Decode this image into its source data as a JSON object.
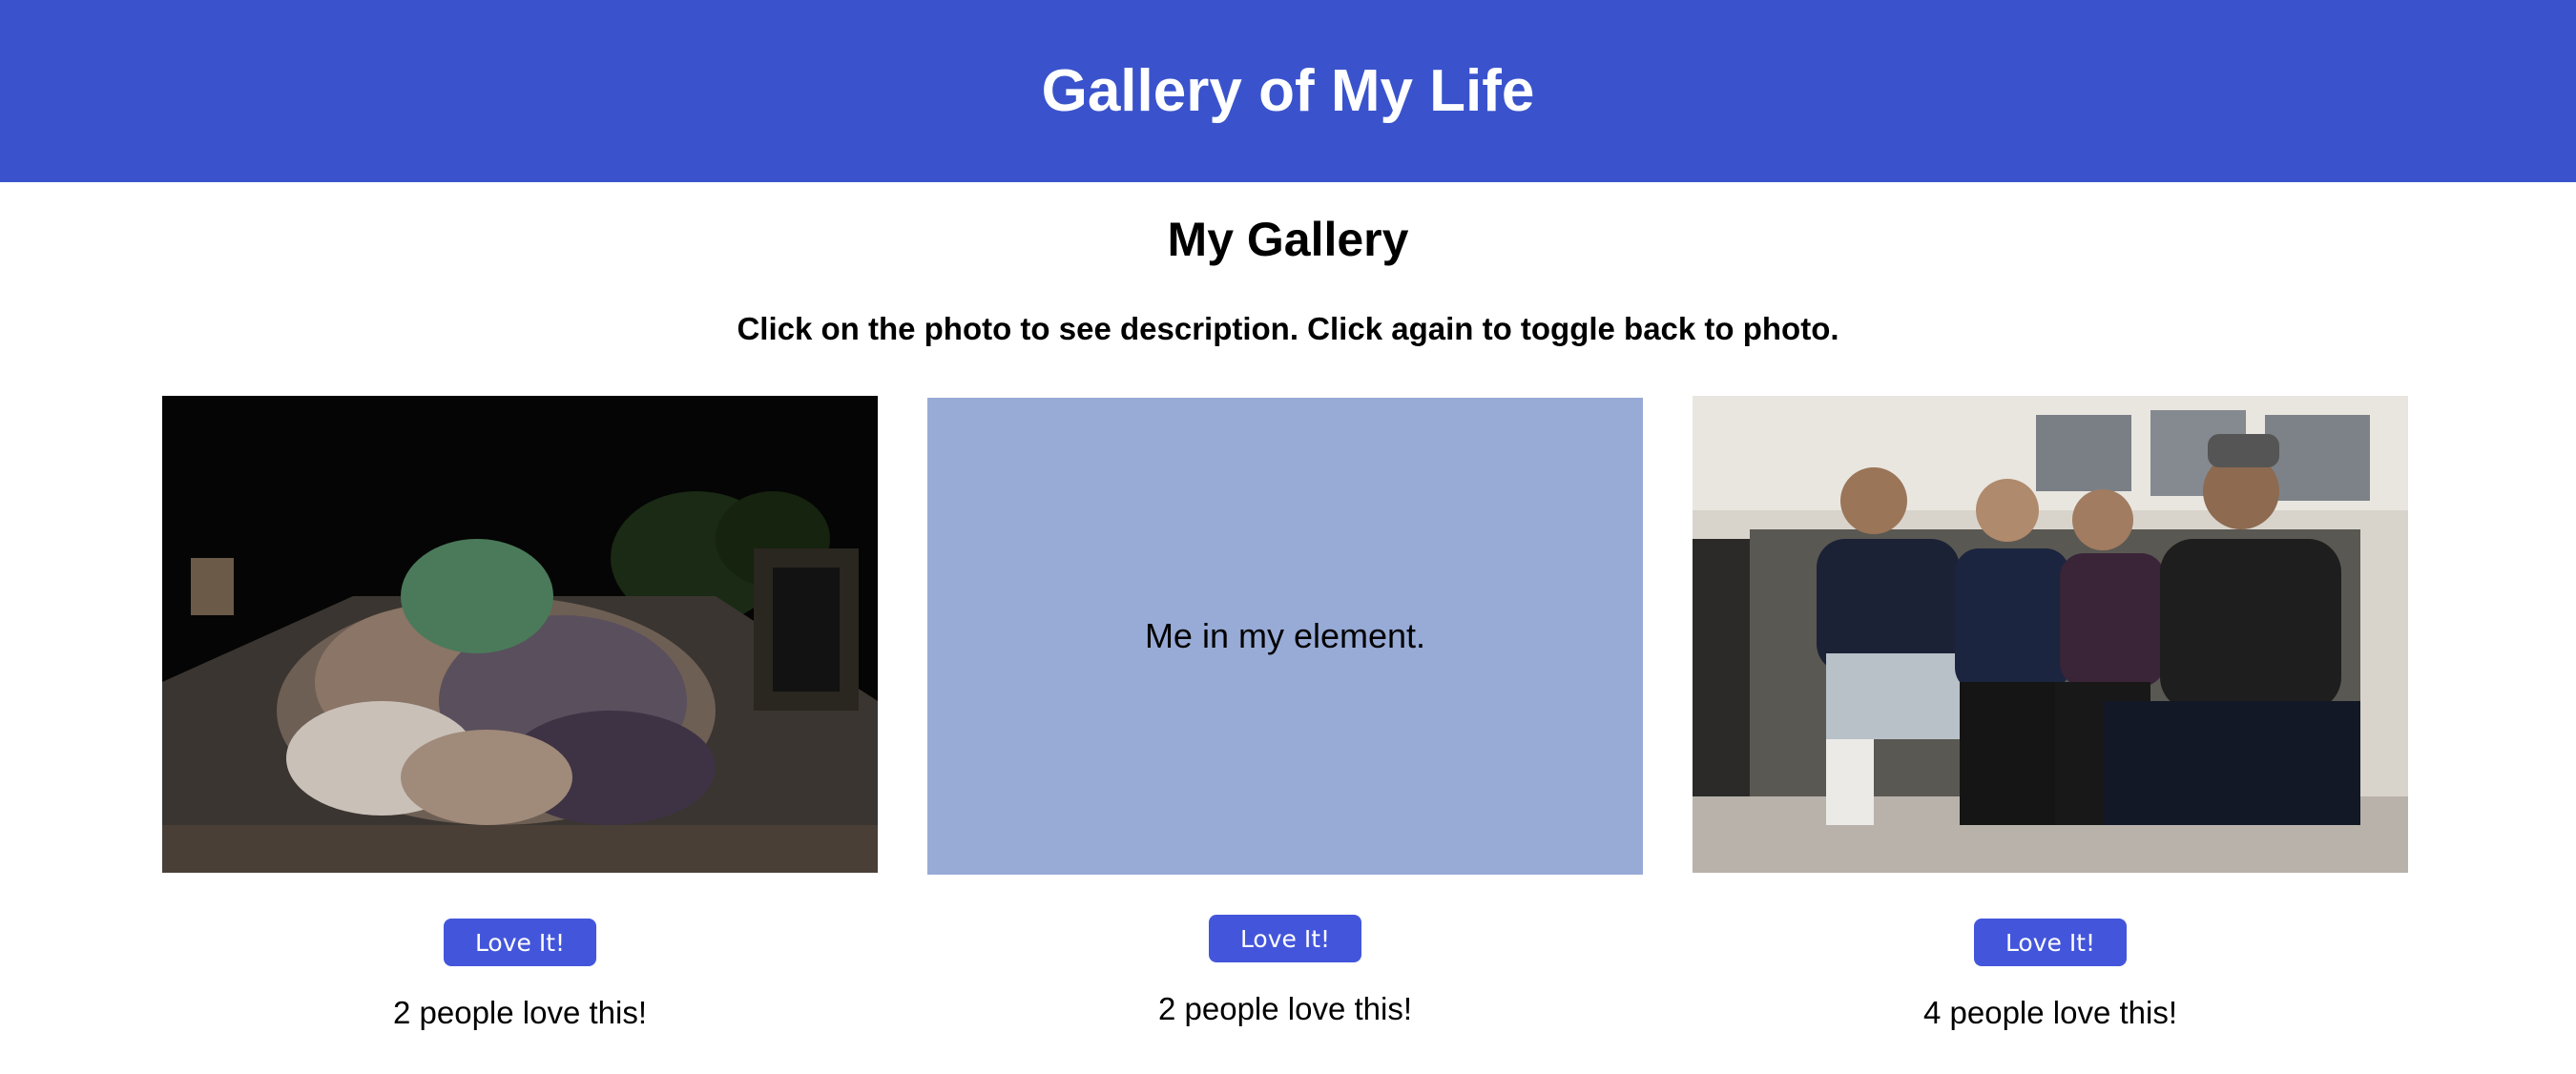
{
  "header": {
    "title": "Gallery of My Life"
  },
  "gallery": {
    "title": "My Gallery",
    "instructions": "Click on the photo to see description. Click again to toggle back to photo."
  },
  "cards": [
    {
      "love_label": "Love It!",
      "love_count": "2 people love this!"
    },
    {
      "description": "Me in my element.",
      "love_label": "Love It!",
      "love_count": "2 people love this!"
    },
    {
      "love_label": "Love It!",
      "love_count": "4 people love this!"
    }
  ],
  "colors": {
    "header_bg": "#3a53cc",
    "button_bg": "#4356db",
    "description_bg": "#98abd7"
  }
}
